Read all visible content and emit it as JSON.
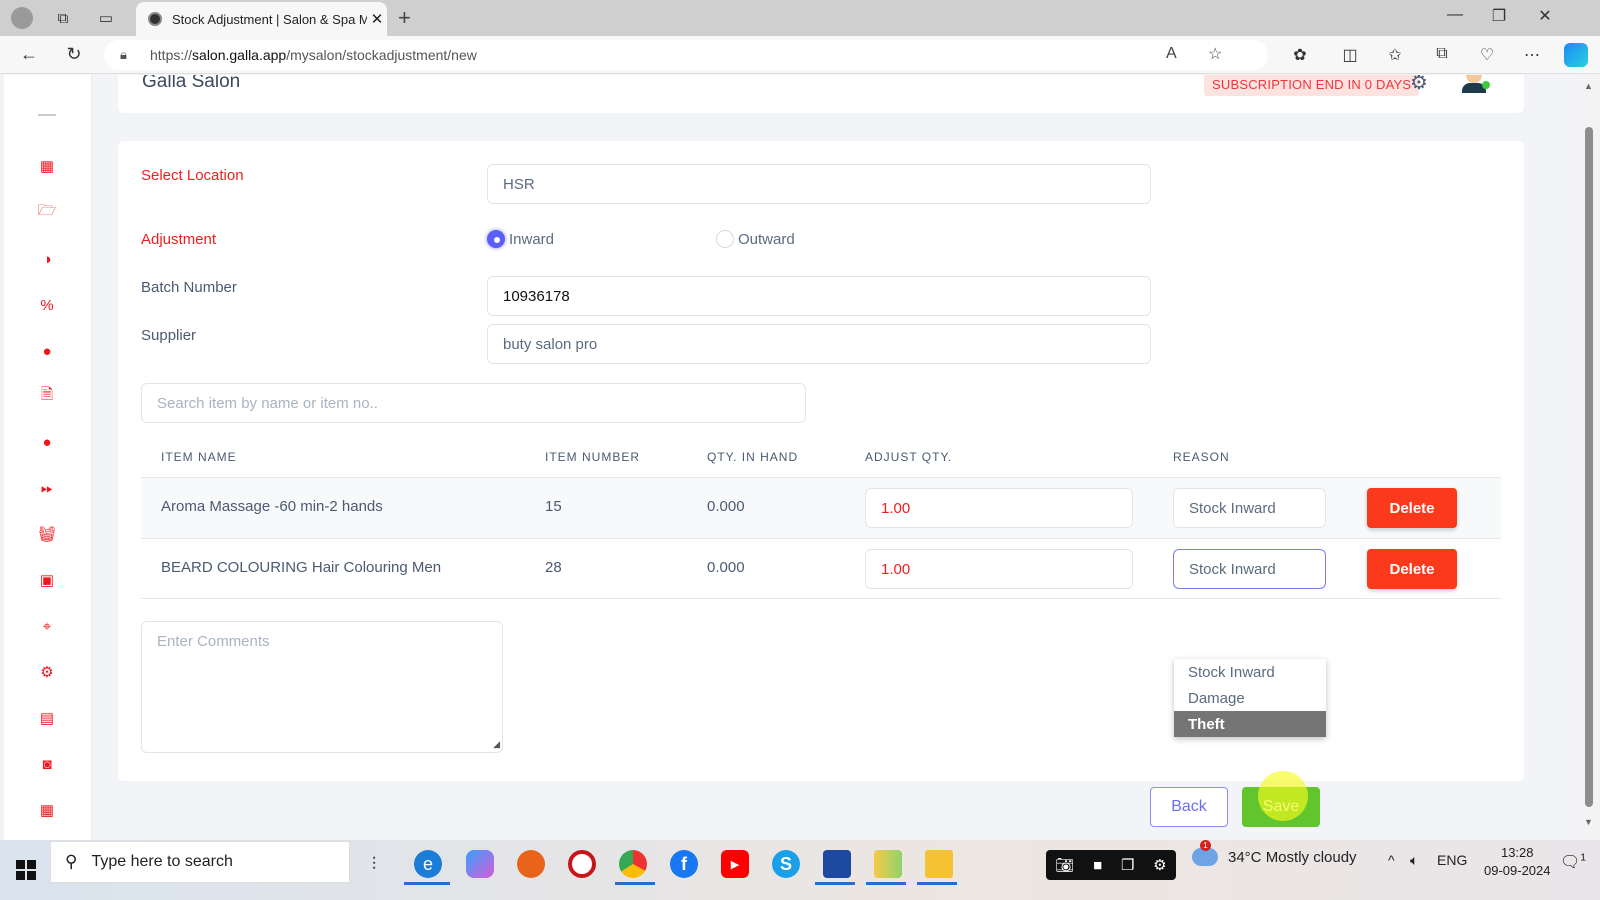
{
  "browser": {
    "tab_title": "Stock Adjustment | Salon & Spa M",
    "new_tab_icon": "+",
    "url_scheme": "https://",
    "url_host": "salon.galla.app",
    "url_path": "/mysalon/stockadjustment/new"
  },
  "header": {
    "brand": "Galla Salon",
    "subscription_badge": "SUBSCRIPTION END IN 0 DAYS"
  },
  "sidebar": {
    "items": [
      {
        "icon": "dashboard-icon"
      },
      {
        "icon": "folder-open-icon"
      },
      {
        "icon": "contrast-icon"
      },
      {
        "icon": "coupon-icon"
      },
      {
        "icon": "user-circle-icon"
      },
      {
        "icon": "document-icon"
      },
      {
        "icon": "user-circle-icon"
      },
      {
        "icon": "fast-forward-icon"
      },
      {
        "icon": "basket-icon"
      },
      {
        "icon": "contacts-icon"
      },
      {
        "icon": "location-pin-icon"
      },
      {
        "icon": "gear-icon"
      },
      {
        "icon": "report-icon"
      },
      {
        "icon": "cash-icon"
      },
      {
        "icon": "calendar-icon"
      }
    ]
  },
  "form": {
    "location_label": "Select Location",
    "location_value": "HSR",
    "adjustment_label": "Adjustment",
    "adjustment_options": [
      "Inward",
      "Outward"
    ],
    "adjustment_selected": "Inward",
    "batch_label": "Batch Number",
    "batch_value": "10936178",
    "supplier_label": "Supplier",
    "supplier_value": "buty salon pro",
    "search_placeholder": "Search item by name or item no..",
    "comments_placeholder": "Enter Comments"
  },
  "table": {
    "headers": [
      "ITEM NAME",
      "ITEM NUMBER",
      "QTY. IN HAND",
      "ADJUST QTY.",
      "REASON"
    ],
    "rows": [
      {
        "name": "Aroma Massage -60 min-2 hands",
        "number": "15",
        "in_hand": "0.000",
        "adjust": "1.00",
        "reason": "Stock Inward",
        "delete": "Delete"
      },
      {
        "name": "BEARD COLOURING Hair Colouring Men",
        "number": "28",
        "in_hand": "0.000",
        "adjust": "1.00",
        "reason": "Stock Inward",
        "delete": "Delete"
      }
    ],
    "reason_dropdown": {
      "options": [
        "Stock Inward",
        "Damage",
        "Theft"
      ],
      "highlighted": "Theft"
    }
  },
  "actions": {
    "back": "Back",
    "save": "Save"
  },
  "taskbar": {
    "search_placeholder": "Type here to search",
    "weather_temp": "34°C",
    "weather_desc": "Mostly cloudy",
    "weather_badge": "1",
    "language": "ENG",
    "time": "13:28",
    "date": "09-09-2024",
    "notifications": "1"
  },
  "colors": {
    "accent_red": "#f01e1e",
    "delete_red": "#fb3a1c",
    "save_green": "#62c52d",
    "primary_purple": "#5b5ef5"
  }
}
